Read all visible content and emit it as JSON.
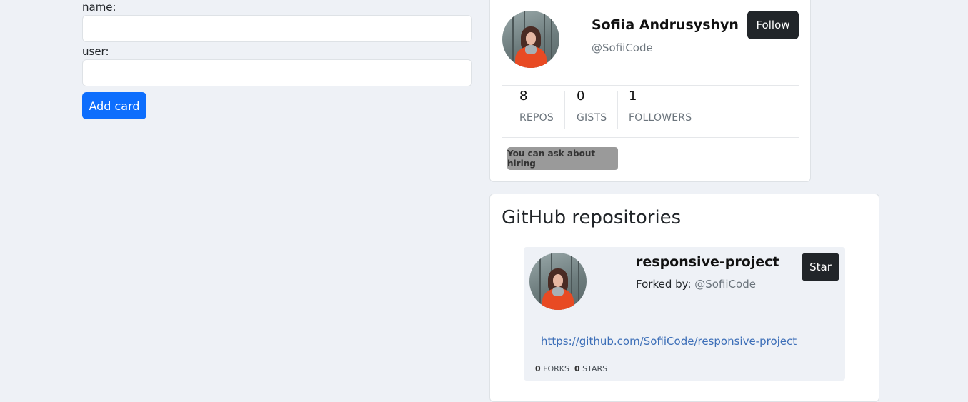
{
  "form": {
    "name_label": "name:",
    "user_label": "user:",
    "name_value": "",
    "user_value": "",
    "add_button": "Add card"
  },
  "profile": {
    "name": "Sofiia Andrusyshyn",
    "handle": "@SofiiCode",
    "follow_button": "Follow",
    "stats": [
      {
        "value": "8",
        "label": "REPOS"
      },
      {
        "value": "0",
        "label": "GISTS"
      },
      {
        "value": "1",
        "label": "FOLLOWERS"
      }
    ],
    "badge": "You can ask about hiring"
  },
  "repos": {
    "title": "GitHub repositories",
    "items": [
      {
        "name": "responsive-project",
        "forked_label": "Forked by:",
        "forked_handle": "@SofiiCode",
        "star_button": "Star",
        "url": "https://github.com/SofiiCode/responsive-project",
        "forks": "0",
        "forks_label": "FORKS",
        "stars": "0",
        "stars_label": "STARS"
      }
    ]
  },
  "colors": {
    "background": "#eef1f6",
    "primary": "#0d6efd",
    "dark_button": "#212529",
    "link": "#3d6fb8",
    "badge": "#9a9a9a"
  }
}
